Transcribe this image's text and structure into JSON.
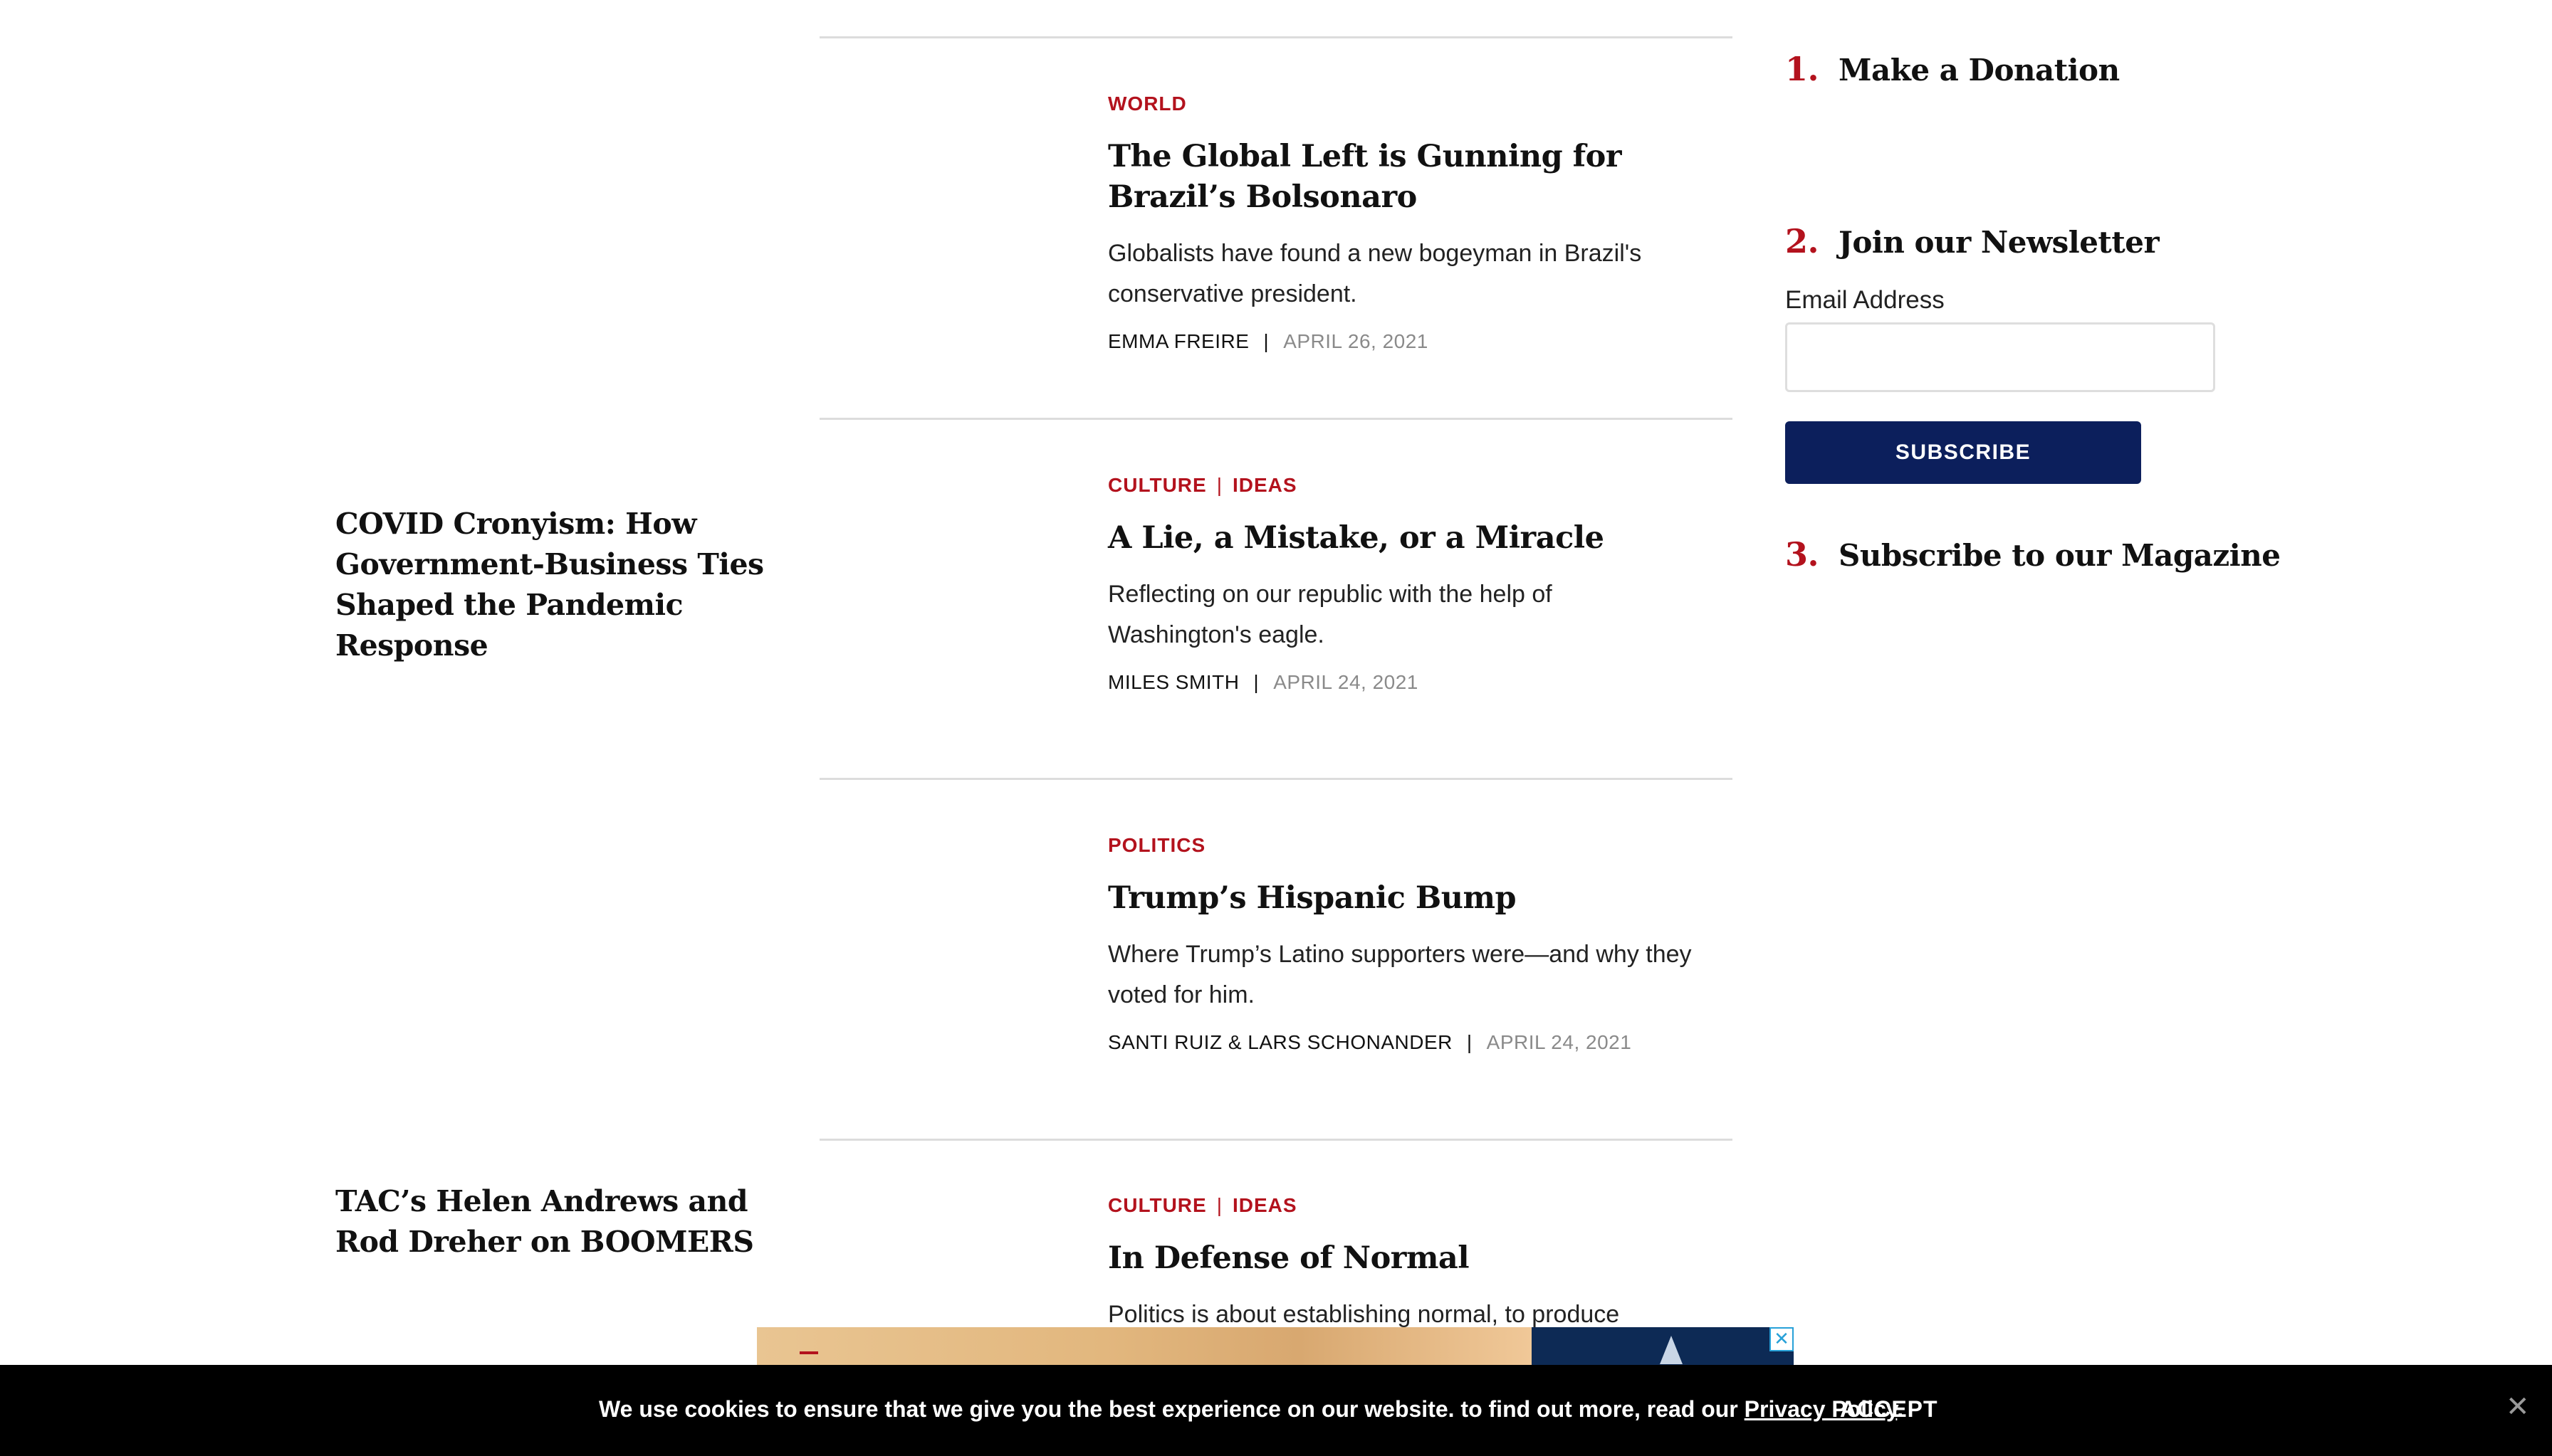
{
  "left_cards": [
    {
      "title": "COVID Cronyism: How Government-Business Ties Shaped the Pandemic Response"
    },
    {
      "title": "TAC’s Helen Andrews and Rod Dreher on BOOMERS"
    }
  ],
  "articles": [
    {
      "categories": [
        "WORLD"
      ],
      "title": "The Global Left is Gunning for Brazil’s Bolsonaro",
      "dek": "Globalists have found a new bogeyman in Brazil's conservative president.",
      "author": "EMMA FREIRE",
      "date": "APRIL 26, 2021"
    },
    {
      "categories": [
        "CULTURE",
        "IDEAS"
      ],
      "title": "A Lie, a Mistake, or a Miracle",
      "dek": "Reflecting on our republic with the help of Washington's eagle.",
      "author": "MILES SMITH",
      "date": "APRIL 24, 2021"
    },
    {
      "categories": [
        "POLITICS"
      ],
      "title": "Trump’s Hispanic Bump",
      "dek": "Where Trump’s Latino supporters were—and why they voted for him.",
      "author": "SANTI RUIZ & LARS SCHONANDER",
      "date": "APRIL 24, 2021"
    },
    {
      "categories": [
        "CULTURE",
        "IDEAS"
      ],
      "title": "In Defense of Normal",
      "dek": "Politics is about establishing normal, to produce"
    }
  ],
  "sidebar": {
    "donate": {
      "num": "1.",
      "label": "Make a Donation"
    },
    "newsletter": {
      "num": "2.",
      "label": "Join our Newsletter",
      "email_label": "Email Address",
      "email_value": "",
      "button": "SUBSCRIBE"
    },
    "magazine": {
      "num": "3.",
      "label": "Subscribe to our Magazine"
    }
  },
  "cookie": {
    "text": "We use cookies to ensure that we give you the best experience on our website. to find out more, read our ",
    "link": "Privacy Policy",
    "period": ".",
    "accept": "ACCEPT",
    "close": "✕"
  },
  "ad": {
    "close": "✕"
  },
  "colors": {
    "accent_red": "#b3121d",
    "navy": "#0c1f5c"
  }
}
